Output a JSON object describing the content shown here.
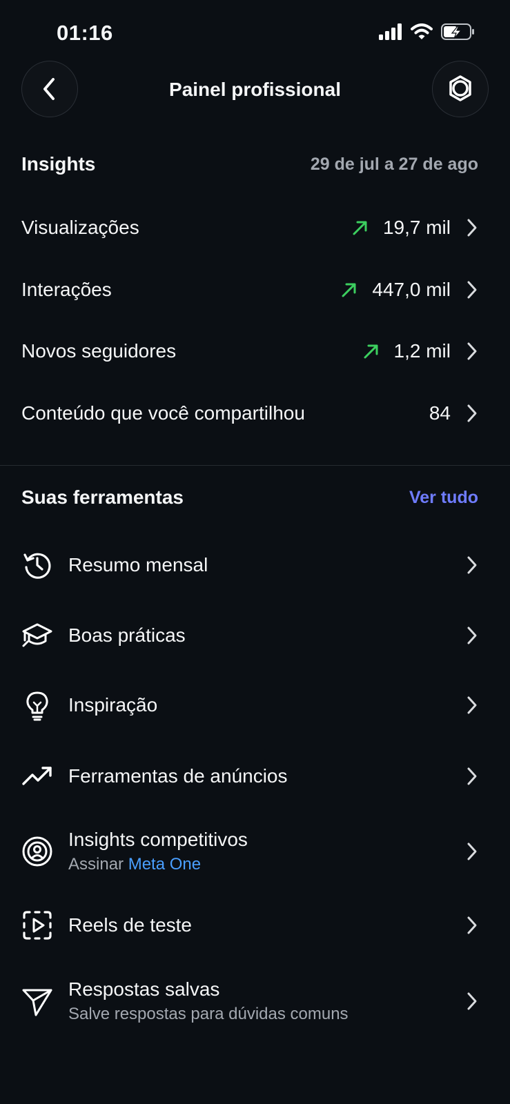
{
  "status": {
    "time": "01:16"
  },
  "header": {
    "title": "Painel profissional"
  },
  "insights": {
    "title": "Insights",
    "date_range": "29 de jul a 27 de ago",
    "metrics": [
      {
        "label": "Visualizações",
        "value": "19,7 mil",
        "trend": "up"
      },
      {
        "label": "Interações",
        "value": "447,0 mil",
        "trend": "up"
      },
      {
        "label": "Novos seguidores",
        "value": "1,2 mil",
        "trend": "up"
      },
      {
        "label": "Conteúdo que você compartilhou",
        "value": "84",
        "trend": "none"
      }
    ]
  },
  "tools": {
    "title": "Suas ferramentas",
    "see_all": "Ver tudo",
    "items": [
      {
        "label": "Resumo mensal",
        "icon": "history-clock-icon"
      },
      {
        "label": "Boas práticas",
        "icon": "graduation-cap-icon"
      },
      {
        "label": "Inspiração",
        "icon": "lightbulb-icon"
      },
      {
        "label": "Ferramentas de anúncios",
        "icon": "trending-up-icon"
      },
      {
        "label": "Insights competitivos",
        "icon": "target-person-icon",
        "sub_prefix": "Assinar",
        "sub_link": "Meta One"
      },
      {
        "label": "Reels de teste",
        "icon": "reels-test-icon"
      },
      {
        "label": "Respostas salvas",
        "icon": "paper-plane-icon",
        "sub": "Salve respostas para dúvidas comuns"
      }
    ]
  },
  "colors": {
    "background": "#0b0f14",
    "trend_up": "#3ccf5f",
    "link_purple": "#6f7cff",
    "link_blue": "#4a9fff"
  }
}
